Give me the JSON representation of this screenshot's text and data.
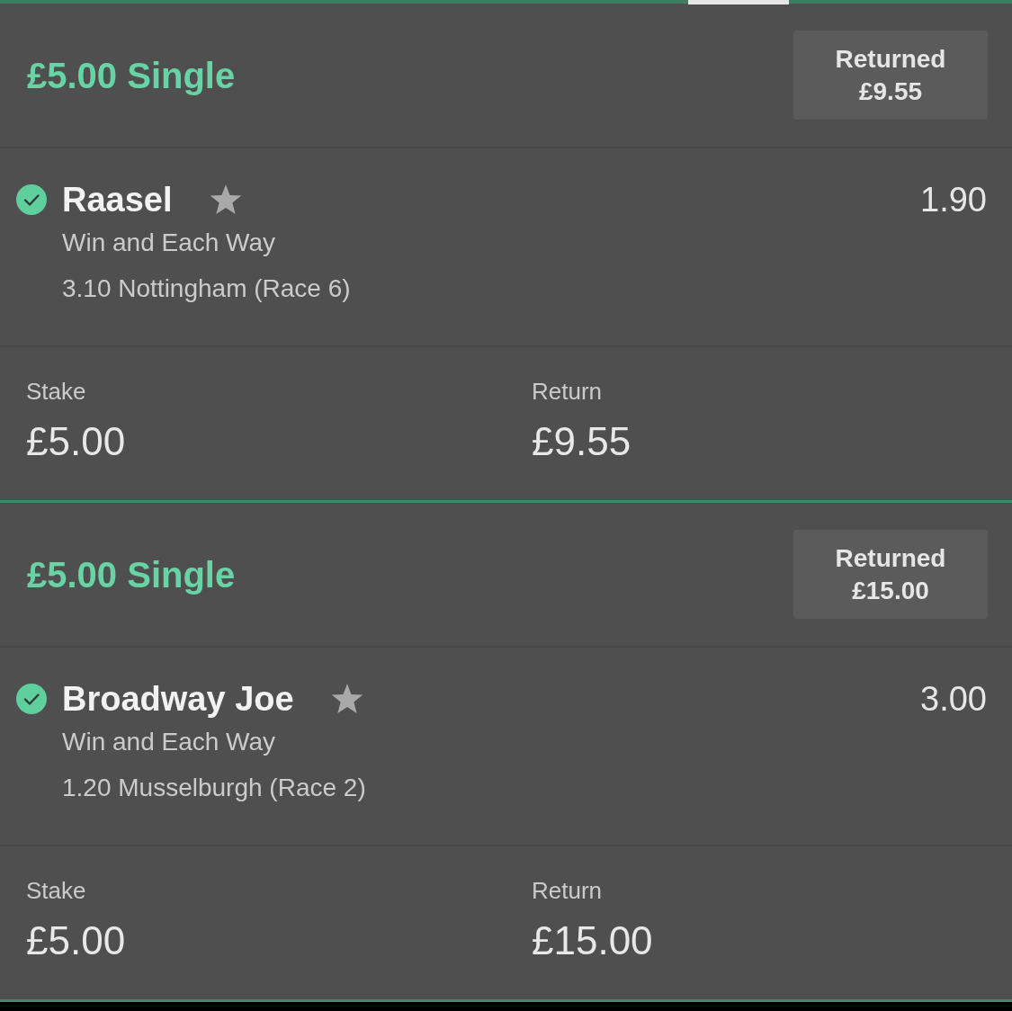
{
  "bets": [
    {
      "title": "£5.00 Single",
      "returned": {
        "label": "Returned",
        "amount": "£9.55"
      },
      "selection": {
        "won": true,
        "name": "Raasel",
        "market": "Win and Each Way",
        "event": "3.10 Nottingham (Race 6)",
        "odds": "1.90"
      },
      "stake": {
        "label": "Stake",
        "value": "£5.00"
      },
      "return": {
        "label": "Return",
        "value": "£9.55"
      }
    },
    {
      "title": "£5.00 Single",
      "returned": {
        "label": "Returned",
        "amount": "£15.00"
      },
      "selection": {
        "won": true,
        "name": "Broadway Joe",
        "market": "Win and Each Way",
        "event": "1.20 Musselburgh (Race 2)",
        "odds": "3.00"
      },
      "stake": {
        "label": "Stake",
        "value": "£5.00"
      },
      "return": {
        "label": "Return",
        "value": "£15.00"
      }
    }
  ]
}
